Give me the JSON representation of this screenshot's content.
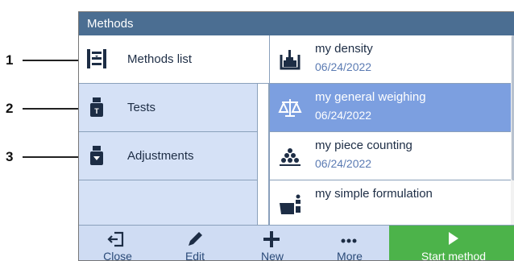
{
  "callouts": [
    "1",
    "2",
    "3"
  ],
  "window": {
    "title": "Methods"
  },
  "tabs": [
    {
      "label": "Methods list",
      "icon": "methods-list-icon",
      "active": true
    },
    {
      "label": "Tests",
      "icon": "test-weight-icon",
      "active": false
    },
    {
      "label": "Adjustments",
      "icon": "adjustment-weight-icon",
      "active": false
    }
  ],
  "methods": [
    {
      "name": "my density",
      "date": "06/24/2022",
      "icon": "density-icon",
      "selected": false
    },
    {
      "name": "my general weighing",
      "date": "06/24/2022",
      "icon": "scale-balance-icon",
      "selected": true
    },
    {
      "name": "my piece counting",
      "date": "06/24/2022",
      "icon": "piece-counting-icon",
      "selected": false
    },
    {
      "name": "my simple formulation",
      "date": "",
      "icon": "formulation-icon",
      "selected": false
    }
  ],
  "toolbar": {
    "close": "Close",
    "edit": "Edit",
    "new": "New",
    "more": "More",
    "start": "Start method"
  },
  "colors": {
    "titlebar": "#4b6e92",
    "tab_bg": "#d5e1f6",
    "selected_row": "#7c9fe0",
    "start_button": "#4cb34a"
  }
}
